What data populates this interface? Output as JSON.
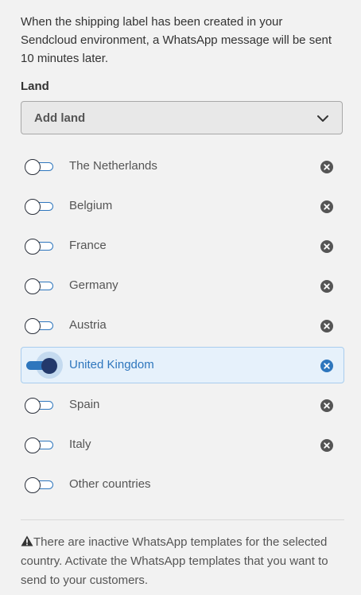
{
  "description": "When the shipping label has been created in your Sendcloud environment, a WhatsApp message will be sent 10 minutes later.",
  "land_label": "Land",
  "select": {
    "placeholder": "Add land",
    "icon": "chevron-down-icon"
  },
  "countries": [
    {
      "name": "The Netherlands",
      "enabled": false,
      "removable": true
    },
    {
      "name": "Belgium",
      "enabled": false,
      "removable": true
    },
    {
      "name": "France",
      "enabled": false,
      "removable": true
    },
    {
      "name": "Germany",
      "enabled": false,
      "removable": true
    },
    {
      "name": "Austria",
      "enabled": false,
      "removable": true
    },
    {
      "name": "United Kingdom",
      "enabled": true,
      "removable": true
    },
    {
      "name": "Spain",
      "enabled": false,
      "removable": true
    },
    {
      "name": "Italy",
      "enabled": false,
      "removable": true
    },
    {
      "name": "Other countries",
      "enabled": false,
      "removable": false
    }
  ],
  "warning": {
    "icon": "warning-icon",
    "text": "There are inactive WhatsApp templates for the selected country. Activate the WhatsApp templates that you want to send to your customers."
  },
  "colors": {
    "accent": "#2e76bd",
    "toggle_on_knob": "#23396b",
    "active_row_bg": "#e6f1fb",
    "remove_icon": "#555555"
  }
}
